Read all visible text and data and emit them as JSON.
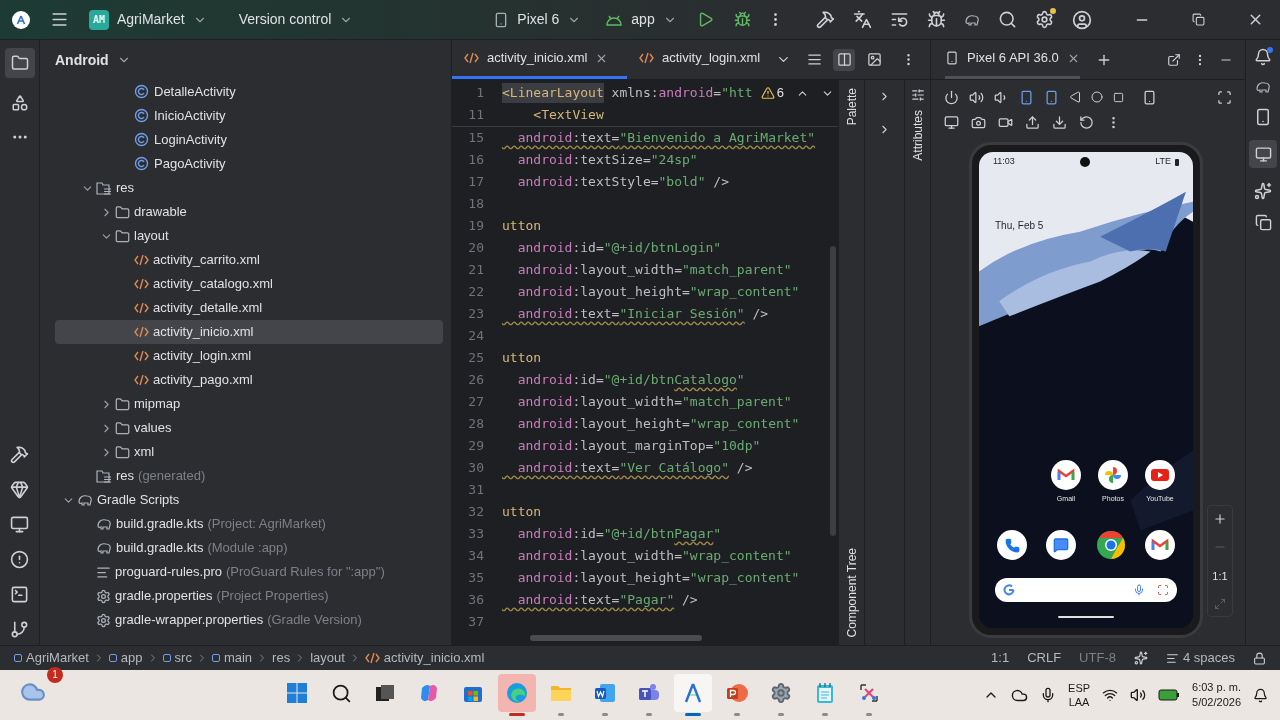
{
  "title_bar": {
    "badge": "AM",
    "project": "AgriMarket",
    "vcs": "Version control",
    "device": "Pixel 6",
    "config": "app"
  },
  "project": {
    "view": "Android",
    "tree": [
      {
        "children": [
          {
            "children": [
              {
                "children": [
                  {
                    "label": "DetalleActivity",
                    "kind": "class",
                    "selected": false
                  },
                  {
                    "label": "InicioActivity",
                    "kind": "class",
                    "selected": false
                  },
                  {
                    "label": "LoginActivity",
                    "kind": "class",
                    "selected": false
                  },
                  {
                    "label": "PagoActivity",
                    "kind": "class",
                    "selected": false
                  }
                ]
              }
            ]
          },
          {
            "label": "res",
            "kind": "res_folder",
            "expanded": true,
            "selected": false,
            "children": [
              {
                "label": "drawable",
                "kind": "folder",
                "expanded": false,
                "selected": false
              },
              {
                "label": "layout",
                "kind": "folder",
                "expanded": true,
                "selected": false,
                "children": [
                  {
                    "label": "activity_carrito.xml",
                    "kind": "xml",
                    "selected": false
                  },
                  {
                    "label": "activity_catalogo.xml",
                    "kind": "xml",
                    "selected": false
                  },
                  {
                    "label": "activity_detalle.xml",
                    "kind": "xml",
                    "selected": false
                  },
                  {
                    "label": "activity_inicio.xml",
                    "kind": "xml",
                    "selected": true
                  },
                  {
                    "label": "activity_login.xml",
                    "kind": "xml",
                    "selected": false
                  },
                  {
                    "label": "activity_pago.xml",
                    "kind": "xml",
                    "selected": false
                  }
                ]
              },
              {
                "label": "mipmap",
                "kind": "folder",
                "expanded": false,
                "selected": false
              },
              {
                "label": "values",
                "kind": "folder",
                "expanded": false,
                "selected": false
              },
              {
                "label": "xml",
                "kind": "folder",
                "expanded": false,
                "selected": false
              }
            ]
          },
          {
            "label": "res",
            "note": "(generated)",
            "kind": "res_folder",
            "selected": false
          }
        ]
      },
      {
        "label": "Gradle Scripts",
        "kind": "gradle",
        "expanded": true,
        "selected": false,
        "children": [
          {
            "label": "build.gradle.kts",
            "note": "(Project: AgriMarket)",
            "kind": "gradle_file",
            "selected": false
          },
          {
            "label": "build.gradle.kts",
            "note": "(Module :app)",
            "kind": "gradle_file",
            "selected": false
          },
          {
            "label": "proguard-rules.pro",
            "note": "(ProGuard Rules for \":app\")",
            "kind": "lines",
            "selected": false
          },
          {
            "label": "gradle.properties",
            "note": "(Project Properties)",
            "kind": "gear",
            "selected": false
          },
          {
            "label": "gradle-wrapper.properties",
            "note": "(Gradle Version)",
            "kind": "gear",
            "selected": false
          }
        ]
      }
    ]
  },
  "editor": {
    "tabs": [
      {
        "label": "activity_inicio.xml",
        "selected": true
      },
      {
        "label": "activity_login.xml",
        "selected": false
      }
    ],
    "view_modes": [
      {
        "kind": "code",
        "selected": false
      },
      {
        "kind": "split",
        "selected": true
      },
      {
        "kind": "design",
        "selected": false
      }
    ],
    "warnings": "6",
    "sticky": [
      {
        "n": "1",
        "tokens": [
          {
            "text": "<LinearLayout",
            "kind": "tag_match",
            "warn": false
          },
          {
            "text": " xmlns:",
            "kind": "plain",
            "warn": false
          },
          {
            "text": "android",
            "kind": "ns",
            "warn": false
          },
          {
            "text": "=",
            "kind": "plain",
            "warn": false
          },
          {
            "text": "\"htt",
            "kind": "str",
            "warn": false
          }
        ]
      },
      {
        "n": "11",
        "tokens": [
          {
            "text": "    <TextView",
            "kind": "tag",
            "warn": false
          }
        ]
      }
    ],
    "lines": [
      {
        "n": "15",
        "tokens": [
          {
            "text": "  android",
            "kind": "ns",
            "warn": true
          },
          {
            "text": ":text=",
            "kind": "plain",
            "warn": true
          },
          {
            "text": "\"Bienvenido a AgriMarket\"",
            "kind": "str",
            "warn": true
          }
        ]
      },
      {
        "n": "16",
        "tokens": [
          {
            "text": "  android",
            "kind": "ns",
            "warn": false
          },
          {
            "text": ":textSize=",
            "kind": "plain",
            "warn": false
          },
          {
            "text": "\"24sp\"",
            "kind": "str",
            "warn": false
          }
        ]
      },
      {
        "n": "17",
        "tokens": [
          {
            "text": "  android",
            "kind": "ns",
            "warn": false
          },
          {
            "text": ":textStyle=",
            "kind": "plain",
            "warn": false
          },
          {
            "text": "\"bold\"",
            "kind": "str",
            "warn": false
          },
          {
            "text": " />",
            "kind": "plain",
            "warn": false
          }
        ]
      },
      {
        "n": "18"
      },
      {
        "n": "19",
        "tokens": [
          {
            "text": "utton",
            "kind": "tag",
            "warn": false
          }
        ]
      },
      {
        "n": "20",
        "tokens": [
          {
            "text": "  android",
            "kind": "ns",
            "warn": false
          },
          {
            "text": ":id=",
            "kind": "plain",
            "warn": false
          },
          {
            "text": "\"@+id/btnLogin\"",
            "kind": "str",
            "warn": false
          }
        ]
      },
      {
        "n": "21",
        "tokens": [
          {
            "text": "  android",
            "kind": "ns",
            "warn": false
          },
          {
            "text": ":layout_width=",
            "kind": "plain",
            "warn": false
          },
          {
            "text": "\"match_parent\"",
            "kind": "str",
            "warn": false
          }
        ]
      },
      {
        "n": "22",
        "tokens": [
          {
            "text": "  android",
            "kind": "ns",
            "warn": false
          },
          {
            "text": ":layout_height=",
            "kind": "plain",
            "warn": false
          },
          {
            "text": "\"wrap_content\"",
            "kind": "str",
            "warn": false
          }
        ]
      },
      {
        "n": "23",
        "tokens": [
          {
            "text": "  android",
            "kind": "ns",
            "warn": true
          },
          {
            "text": ":text=",
            "kind": "plain",
            "warn": true
          },
          {
            "text": "\"Iniciar Sesión\"",
            "kind": "str",
            "warn": true
          },
          {
            "text": " />",
            "kind": "plain",
            "warn": false
          }
        ]
      },
      {
        "n": "24"
      },
      {
        "n": "25",
        "tokens": [
          {
            "text": "utton",
            "kind": "tag",
            "warn": false
          }
        ]
      },
      {
        "n": "26",
        "tokens": [
          {
            "text": "  android",
            "kind": "ns",
            "warn": false
          },
          {
            "text": ":id=",
            "kind": "plain",
            "warn": false
          },
          {
            "text": "\"@+id/btn",
            "kind": "str",
            "warn": false
          },
          {
            "text": "Catalogo",
            "kind": "str",
            "warn": true
          },
          {
            "text": "\"",
            "kind": "str",
            "warn": false
          }
        ]
      },
      {
        "n": "27",
        "tokens": [
          {
            "text": "  android",
            "kind": "ns",
            "warn": false
          },
          {
            "text": ":layout_width=",
            "kind": "plain",
            "warn": false
          },
          {
            "text": "\"match_parent\"",
            "kind": "str",
            "warn": false
          }
        ]
      },
      {
        "n": "28",
        "tokens": [
          {
            "text": "  android",
            "kind": "ns",
            "warn": false
          },
          {
            "text": ":layout_height=",
            "kind": "plain",
            "warn": false
          },
          {
            "text": "\"wrap_content\"",
            "kind": "str",
            "warn": false
          }
        ]
      },
      {
        "n": "29",
        "tokens": [
          {
            "text": "  android",
            "kind": "ns",
            "warn": false
          },
          {
            "text": ":layout_marginTop=",
            "kind": "plain",
            "warn": false
          },
          {
            "text": "\"10dp\"",
            "kind": "str",
            "warn": false
          }
        ]
      },
      {
        "n": "30",
        "tokens": [
          {
            "text": "  android",
            "kind": "ns",
            "warn": true
          },
          {
            "text": ":text=",
            "kind": "plain",
            "warn": true
          },
          {
            "text": "\"Ver Catálogo\"",
            "kind": "str",
            "warn": true
          },
          {
            "text": " />",
            "kind": "plain",
            "warn": false
          }
        ]
      },
      {
        "n": "31"
      },
      {
        "n": "32",
        "tokens": [
          {
            "text": "utton",
            "kind": "tag",
            "warn": false
          }
        ]
      },
      {
        "n": "33",
        "tokens": [
          {
            "text": "  android",
            "kind": "ns",
            "warn": false
          },
          {
            "text": ":id=",
            "kind": "plain",
            "warn": false
          },
          {
            "text": "\"@+id/btn",
            "kind": "str",
            "warn": false
          },
          {
            "text": "Pagar",
            "kind": "str",
            "warn": true
          },
          {
            "text": "\"",
            "kind": "str",
            "warn": false
          }
        ]
      },
      {
        "n": "34",
        "tokens": [
          {
            "text": "  android",
            "kind": "ns",
            "warn": false
          },
          {
            "text": ":layout_width=",
            "kind": "plain",
            "warn": false
          },
          {
            "text": "\"wrap_content\"",
            "kind": "str",
            "warn": false
          }
        ]
      },
      {
        "n": "35",
        "tokens": [
          {
            "text": "  android",
            "kind": "ns",
            "warn": false
          },
          {
            "text": ":layout_height=",
            "kind": "plain",
            "warn": false
          },
          {
            "text": "\"wrap_content\"",
            "kind": "str",
            "warn": false
          }
        ]
      },
      {
        "n": "36",
        "tokens": [
          {
            "text": "  android",
            "kind": "ns",
            "warn": true
          },
          {
            "text": ":text=",
            "kind": "plain",
            "warn": true
          },
          {
            "text": "\"Pagar\"",
            "kind": "str",
            "warn": true
          },
          {
            "text": " />",
            "kind": "plain",
            "warn": false
          }
        ]
      },
      {
        "n": "37"
      }
    ],
    "side_panels": [
      "Palette",
      "Component Tree",
      "Attributes"
    ]
  },
  "running_devices": {
    "tab": "Pixel 6 API 36.0",
    "phone": {
      "time": "11:03",
      "network": "LTE",
      "date": "Thu, Feb 5",
      "apps": [
        {
          "kind": "gmail",
          "label": "Gmail"
        },
        {
          "kind": "photos",
          "label": "Photos"
        },
        {
          "kind": "youtube",
          "label": "YouTube"
        }
      ],
      "dock": [
        {
          "kind": "phone"
        },
        {
          "kind": "messages"
        },
        {
          "kind": "chrome"
        },
        {
          "kind": "gmail"
        }
      ]
    },
    "zoom": "1:1"
  },
  "breadcrumbs": [
    "AgriMarket",
    "app",
    "src",
    "main",
    "res",
    "layout",
    "activity_inicio.xml"
  ],
  "status": {
    "position": "1:1",
    "line_endings": "CRLF",
    "encoding": "UTF-8",
    "indent": "4 spaces"
  },
  "taskbar": {
    "weather_badge": "1",
    "apps": [
      {
        "kind": "start",
        "running": false,
        "active": false
      },
      {
        "kind": "search",
        "running": false,
        "active": false
      },
      {
        "kind": "taskview",
        "running": false,
        "active": false
      },
      {
        "kind": "copilot",
        "running": false,
        "active": false
      },
      {
        "kind": "store",
        "running": false,
        "active": false
      },
      {
        "kind": "edge",
        "running": true,
        "active": true
      },
      {
        "kind": "explorer",
        "running": true,
        "active": false
      },
      {
        "kind": "word",
        "running": true,
        "active": false
      },
      {
        "kind": "teams",
        "running": true,
        "active": false
      },
      {
        "kind": "studio",
        "running": true,
        "active": true
      },
      {
        "kind": "powerpoint",
        "running": true,
        "active": false
      },
      {
        "kind": "settings",
        "running": true,
        "active": false
      },
      {
        "kind": "notepad",
        "running": true,
        "active": false
      },
      {
        "kind": "snipping",
        "running": true,
        "active": false
      }
    ],
    "language": "ESP",
    "layout": "LAA",
    "time": "6:03 p. m.",
    "date": "5/02/2026"
  }
}
